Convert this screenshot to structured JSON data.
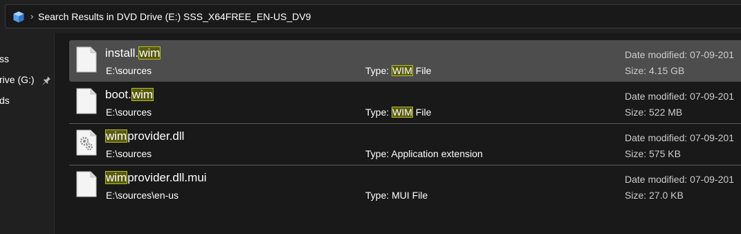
{
  "address_bar": {
    "breadcrumb": "Search Results in DVD Drive (E:) SSS_X64FREE_EN-US_DV9",
    "chevron": "›"
  },
  "sidebar": {
    "items": [
      {
        "label": "ss"
      },
      {
        "label": "rive (G:)"
      },
      {
        "label": "ds"
      }
    ]
  },
  "results": [
    {
      "name_pre": "install.",
      "name_hl": "wim",
      "name_post": "",
      "location": "E:\\sources",
      "type_pre": "Type: ",
      "type_hl": "WIM",
      "type_post": " File",
      "date": "Date modified: 07-09-201",
      "size": "Size: 4.15 GB",
      "selected": true,
      "icon": "file-icon"
    },
    {
      "name_pre": "boot.",
      "name_hl": "wim",
      "name_post": "",
      "location": "E:\\sources",
      "type_pre": "Type: ",
      "type_hl": "WIM",
      "type_post": " File",
      "date": "Date modified: 07-09-201",
      "size": "Size: 522 MB",
      "selected": false,
      "icon": "file-icon"
    },
    {
      "name_pre": "",
      "name_hl": "wim",
      "name_post": "provider.dll",
      "location": "E:\\sources",
      "type_pre": "Type: Application extension",
      "type_hl": "",
      "type_post": "",
      "date": "Date modified: 07-09-201",
      "size": "Size: 575 KB",
      "selected": false,
      "icon": "dll-gear-icon"
    },
    {
      "name_pre": "",
      "name_hl": "wim",
      "name_post": "provider.dll.mui",
      "location": "E:\\sources\\en-us",
      "type_pre": "Type: MUI File",
      "type_hl": "",
      "type_post": "",
      "date": "Date modified: 07-09-201",
      "size": "Size: 27.0 KB",
      "selected": false,
      "icon": "file-icon"
    }
  ],
  "colors": {
    "background": "#191919",
    "selected_row": "#4d4d4d",
    "highlight_fill": "#585a0e",
    "highlight_border": "#b9bc2a"
  }
}
